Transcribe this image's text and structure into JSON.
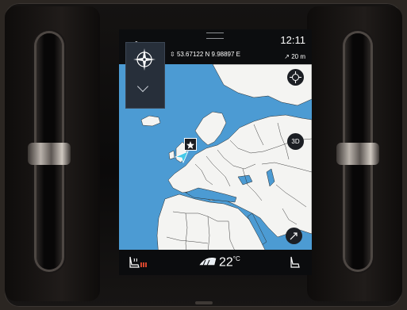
{
  "status": {
    "time": "12:11",
    "coordinates": "53.67122 N 9.98897 E",
    "altitude": "20 m"
  },
  "map": {
    "view_toggle_label": "3D",
    "background_color": "#4c9bd3",
    "land_color": "#f4f4f2"
  },
  "climate": {
    "temperature": "22",
    "unit": "°C",
    "heat_accent": "#d6462d"
  },
  "icons": {
    "compass": "compass-icon",
    "collapse": "chevron-down-icon",
    "recenter": "crosshair-icon",
    "destination": "star-icon",
    "vehicle": "vehicle-arrow-icon",
    "seat_heat_left": "seat-heat-icon",
    "seat_right": "seat-icon",
    "defrost": "defrost-icon"
  }
}
